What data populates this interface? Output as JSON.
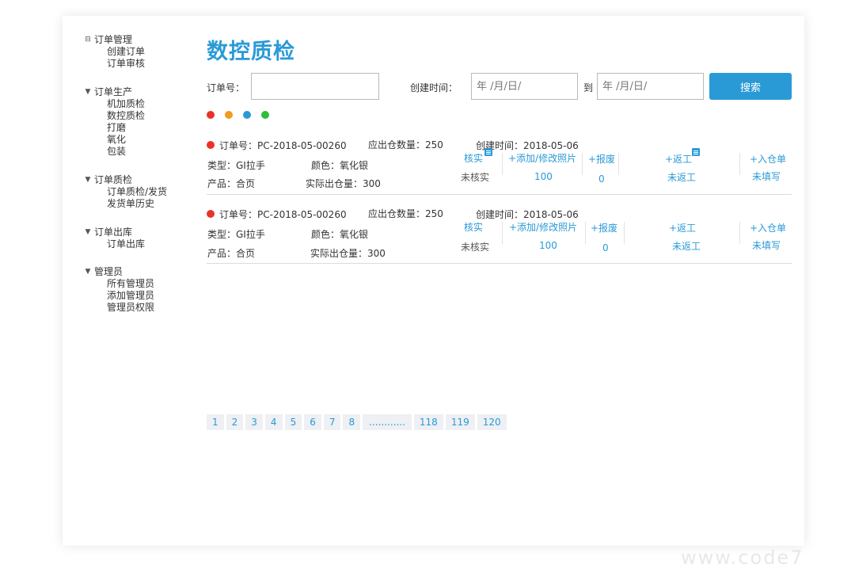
{
  "sidebar": {
    "groups": [
      {
        "label": "订单管理",
        "toggle": "⊟",
        "items": [
          "创建订单",
          "订单审核"
        ]
      },
      {
        "label": "订单生产",
        "toggle": "▼",
        "items": [
          "机加质检",
          "数控质检",
          "打磨",
          "氧化",
          "包装"
        ]
      },
      {
        "label": "订单质检",
        "toggle": "▼",
        "items": [
          "订单质检/发货",
          "发货单历史"
        ]
      },
      {
        "label": "订单出库",
        "toggle": "▼",
        "items": [
          "订单出库"
        ]
      },
      {
        "label": "管理员",
        "toggle": "▼",
        "items": [
          "所有管理员",
          "添加管理员",
          "管理员权限"
        ]
      }
    ]
  },
  "page_title": "数控质检",
  "search": {
    "order_label": "订单号：",
    "order_value": "",
    "created_label": "创建时间：",
    "date_from_placeholder": "年 /月/日/",
    "to_label": "到",
    "date_to_placeholder": "年 /月/日/",
    "button_label": "搜索"
  },
  "legend_colors": [
    "#e8332a",
    "#f39a1e",
    "#2a9ad6",
    "#2dbd3a"
  ],
  "orders": [
    {
      "order_no": "订单号：PC-2018-05-00260",
      "expected_qty": "应出仓数量：250",
      "created": "创建时间：2018-05-06",
      "type": "类型：GI拉手",
      "color": "颜色：氧化银",
      "product": "产品：合页",
      "actual_qty": "实际出仓量：300",
      "verify_label": "核实",
      "verify_value": "未核实",
      "photo_label": "+添加/修改照片",
      "photo_value": "100",
      "scrap_label": "+报废",
      "scrap_value": "0",
      "rework_label": "+返工",
      "rework_value": "未返工",
      "inbound_label": "+入仓单",
      "inbound_value": "未填写"
    },
    {
      "order_no": "订单号：PC-2018-05-00260",
      "expected_qty": "应出仓数量：250",
      "created": "创建时间：2018-05-06",
      "type": "类型：GI拉手",
      "color": "颜色：氧化银",
      "product": "产品：合页",
      "actual_qty": "实际出仓量：300",
      "verify_label": "核实",
      "verify_value": "未核实",
      "photo_label": "+添加/修改照片",
      "photo_value": "100",
      "scrap_label": "+报废",
      "scrap_value": "0",
      "rework_label": "+返工",
      "rework_value": "未返工",
      "inbound_label": "+入仓单",
      "inbound_value": "未填写"
    }
  ],
  "pagination": [
    "1",
    "2",
    "3",
    "4",
    "5",
    "6",
    "7",
    "8",
    "............",
    "118",
    "119",
    "120"
  ],
  "watermark": "www.code7"
}
